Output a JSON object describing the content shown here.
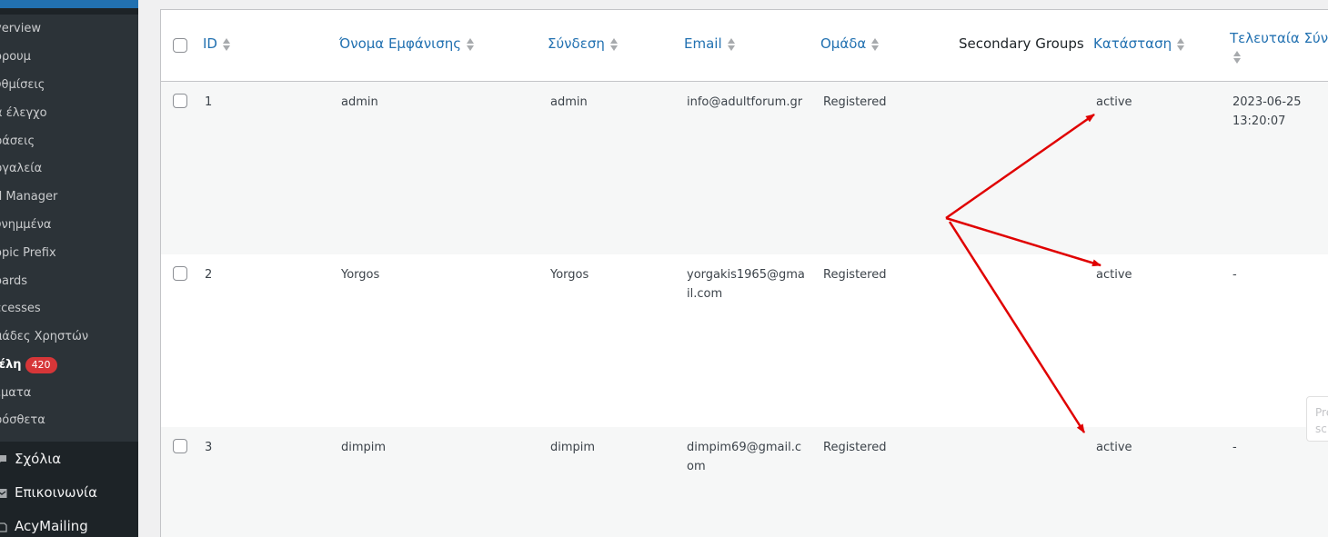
{
  "sidebar": {
    "submenu": [
      {
        "label": "verview"
      },
      {
        "label": "όρουμ"
      },
      {
        "label": "υθμίσεις"
      },
      {
        "label": "α έλεγχο"
      },
      {
        "label": "ράσεις"
      },
      {
        "label": "ργαλεία"
      },
      {
        "label": "d Manager"
      },
      {
        "label": "υνημμένα"
      },
      {
        "label": "opic Prefix"
      },
      {
        "label": "oards"
      },
      {
        "label": "ccesses"
      },
      {
        "label": "μάδες Χρηστών"
      },
      {
        "label": "Ιέλη",
        "badge": "420"
      },
      {
        "label": "έματα"
      },
      {
        "label": "ρόσθετα"
      }
    ],
    "main": [
      {
        "label": "Σχόλια",
        "icon": "comment-icon"
      },
      {
        "label": "Επικοινωνία",
        "icon": "mail-icon"
      },
      {
        "label": "AcyMailing",
        "icon": "acymailing-icon"
      }
    ]
  },
  "table": {
    "columns": [
      {
        "label": "ID",
        "sortable": true
      },
      {
        "label": "Όνομα Εμφάνισης",
        "sortable": true
      },
      {
        "label": "Σύνδεση",
        "sortable": true
      },
      {
        "label": "Email",
        "sortable": true
      },
      {
        "label": "Ομάδα",
        "sortable": true
      },
      {
        "label": "Secondary Groups",
        "sortable": false
      },
      {
        "label": "Κατάσταση",
        "sortable": true
      },
      {
        "label": "Τελευταία Σύνδ",
        "sortable": true
      }
    ],
    "rows": [
      {
        "id": "1",
        "display_name": "admin",
        "login": "admin",
        "email": "info@adultforum.gr",
        "group": "Registered",
        "secondary": "",
        "status": "active",
        "last_login": "2023-06-25 13:20:07"
      },
      {
        "id": "2",
        "display_name": "Yorgos",
        "login": "Yorgos",
        "email": "yorgakis1965@gmail.com",
        "group": "Registered",
        "secondary": "",
        "status": "active",
        "last_login": "-"
      },
      {
        "id": "3",
        "display_name": "dimpim",
        "login": "dimpim",
        "email": "dimpim69@gmail.com",
        "group": "Registered",
        "secondary": "",
        "status": "active",
        "last_login": "-"
      }
    ]
  },
  "peek_text": "Pre sc",
  "colors": {
    "sidebar_bg": "#1d2327",
    "submenu_bg": "#2c3338",
    "link_blue": "#2271b1",
    "badge_red": "#d63638",
    "annotation_red": "#e00000"
  }
}
